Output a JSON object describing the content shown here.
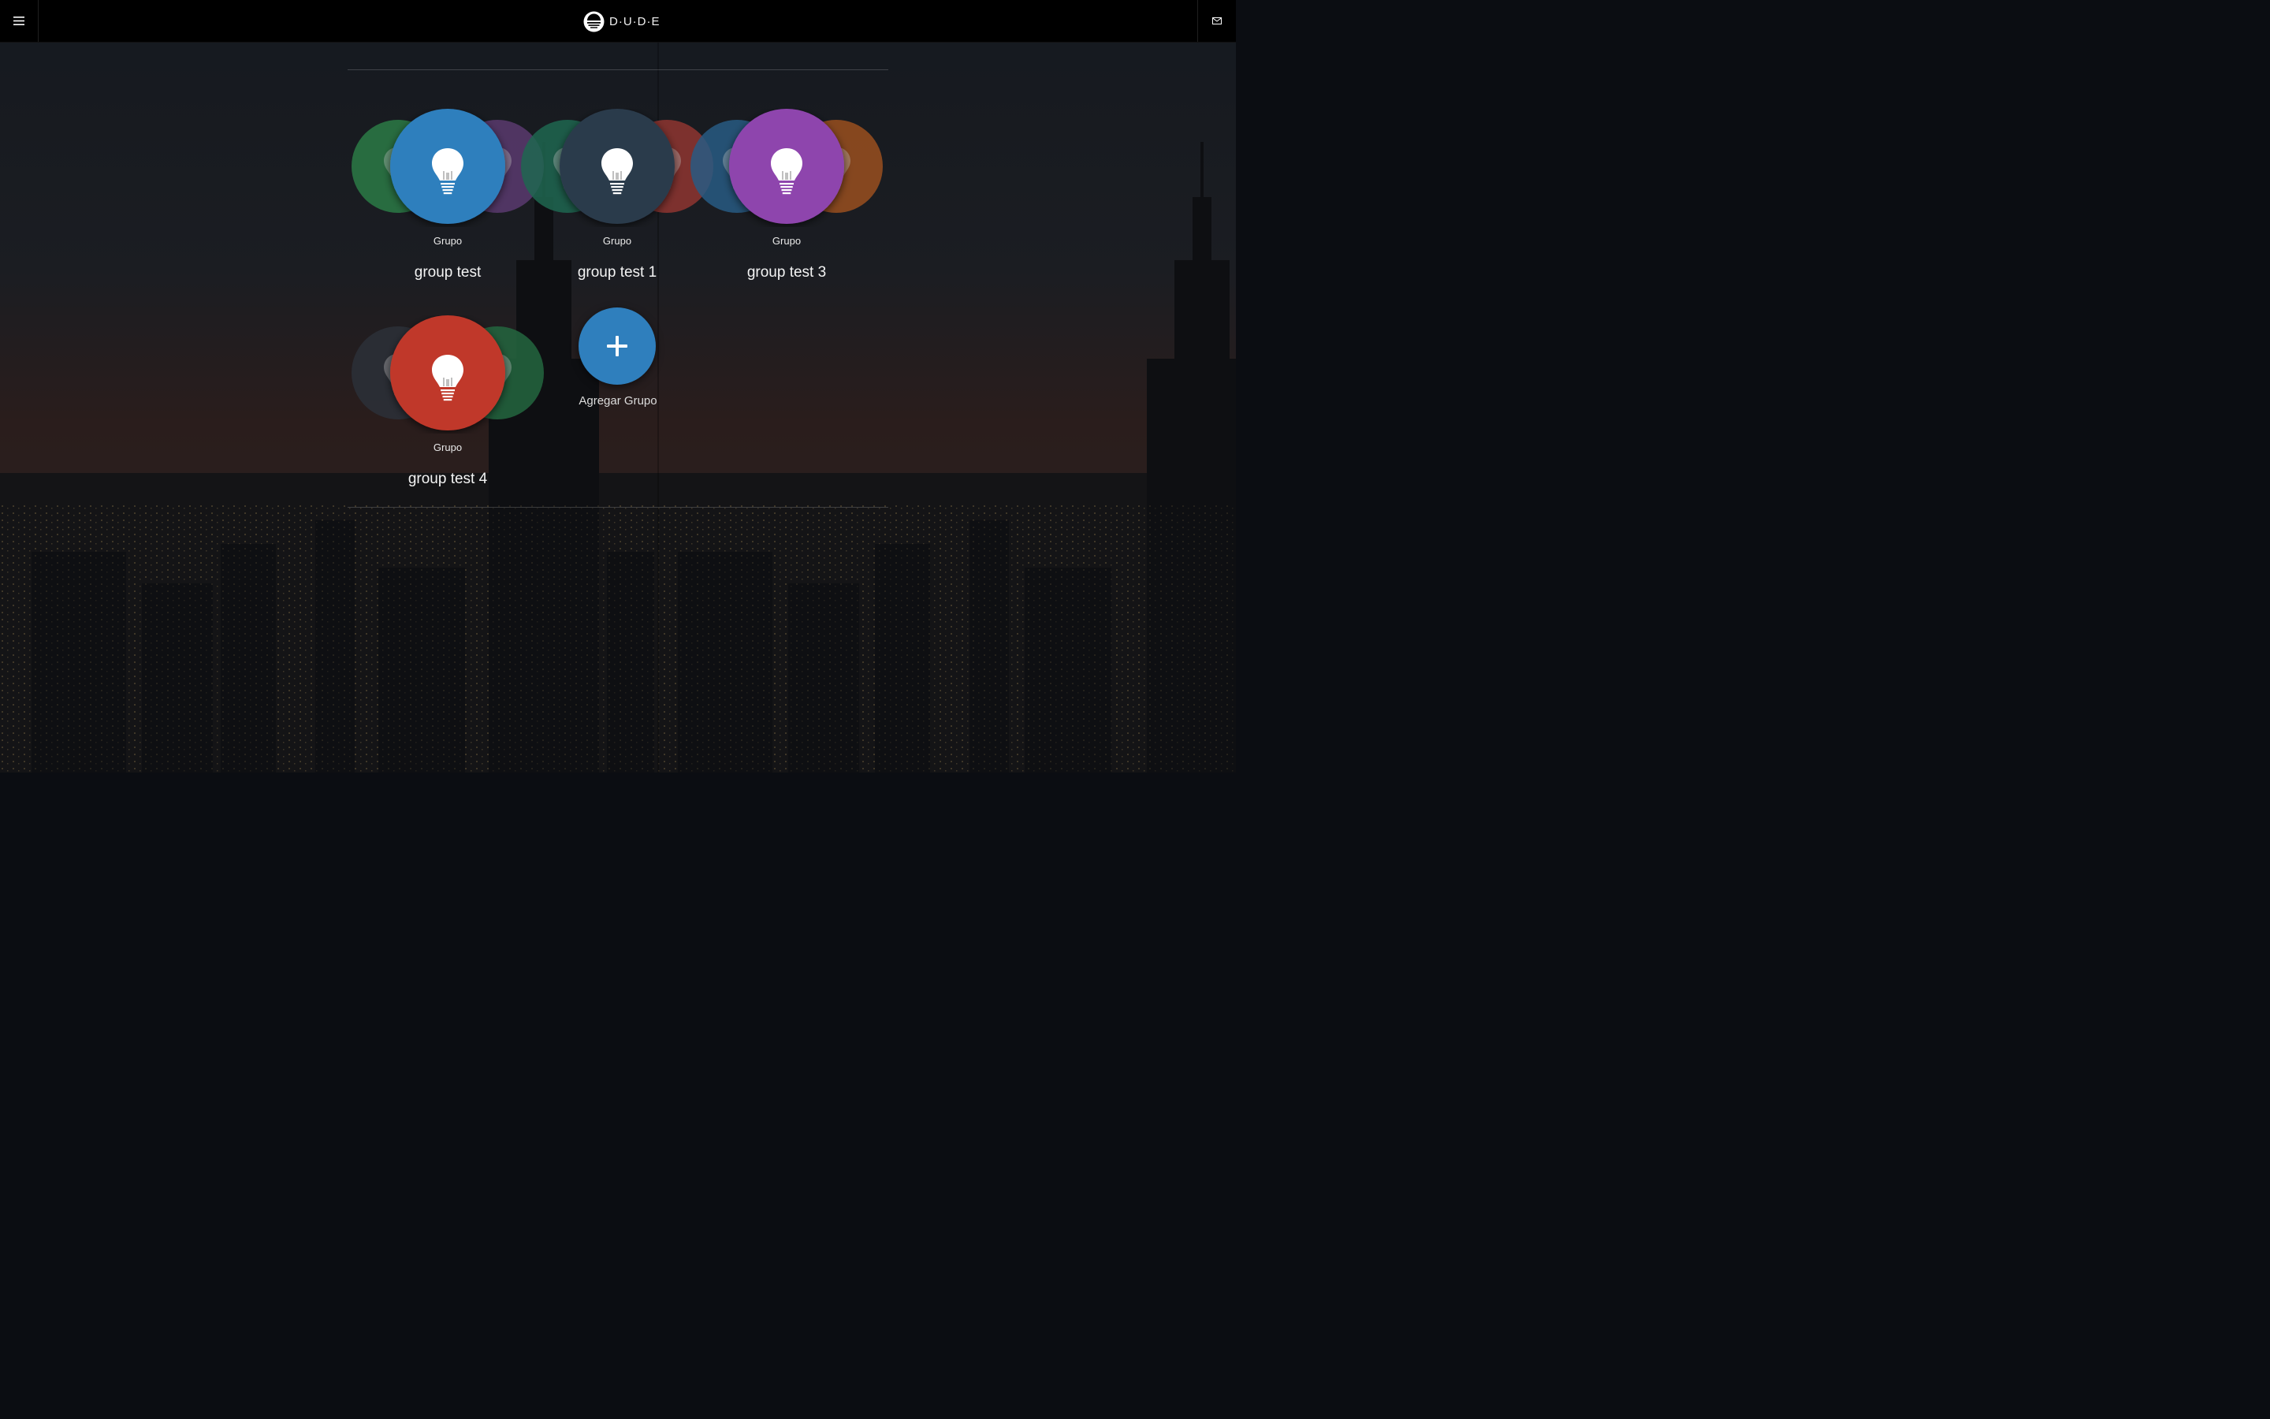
{
  "header": {
    "brand_text": "D·U·D·E",
    "menu_icon": "hamburger-menu-icon",
    "mail_icon": "mail-icon",
    "logo_icon": "dude-logo-icon"
  },
  "groups": [
    {
      "type_label": "Grupo",
      "name": "group test",
      "main_color": "#2f7fbd",
      "left_color": "#2b7a45",
      "right_color": "#5b3a6e"
    },
    {
      "type_label": "Grupo",
      "name": "group test 1",
      "main_color": "#2c3a4c",
      "left_color": "#1e6650",
      "right_color": "#8f3530"
    },
    {
      "type_label": "Grupo",
      "name": "group test 3",
      "main_color": "#8e44ad",
      "left_color": "#285b82",
      "right_color": "#9a4f1f"
    },
    {
      "type_label": "Grupo",
      "name": "group test 4",
      "main_color": "#c0392b",
      "left_color": "#2b3038",
      "right_color": "#23663f"
    }
  ],
  "add_group": {
    "label": "Agregar Grupo",
    "icon": "plus-icon",
    "color": "#2f7fbd"
  }
}
